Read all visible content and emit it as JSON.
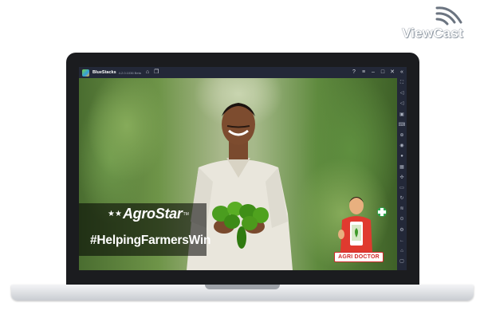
{
  "watermark": {
    "text": "ViewCast"
  },
  "window": {
    "app_name": "BlueStacks",
    "version": "4.2.0.1036 Beta",
    "title_icons": [
      "home-icon",
      "multi-instance-icon"
    ],
    "controls": [
      "help-icon",
      "menu-icon",
      "minimize-icon",
      "maximize-icon",
      "close-icon",
      "expand-icon"
    ]
  },
  "sidebar": {
    "items": [
      "fullscreen-icon",
      "volume-up-icon",
      "volume-down-icon",
      "keymapping-icon",
      "keyboard-icon",
      "install-apk-icon",
      "screenshot-icon",
      "record-icon",
      "gamepad-icon",
      "macro-icon",
      "folder-icon",
      "rotate-icon",
      "shake-icon",
      "location-icon",
      "settings-icon",
      "back-icon",
      "home-icon",
      "recent-apps-icon"
    ]
  },
  "app": {
    "brand": "AgroStar",
    "brand_tm": "TM",
    "hashtag": "#HelpingFarmersWin",
    "badge_label": "AGRI DOCTOR"
  },
  "colors": {
    "titlebar": "#232838",
    "badge_red": "#d02a2a",
    "bezel": "#1b1c1f"
  }
}
